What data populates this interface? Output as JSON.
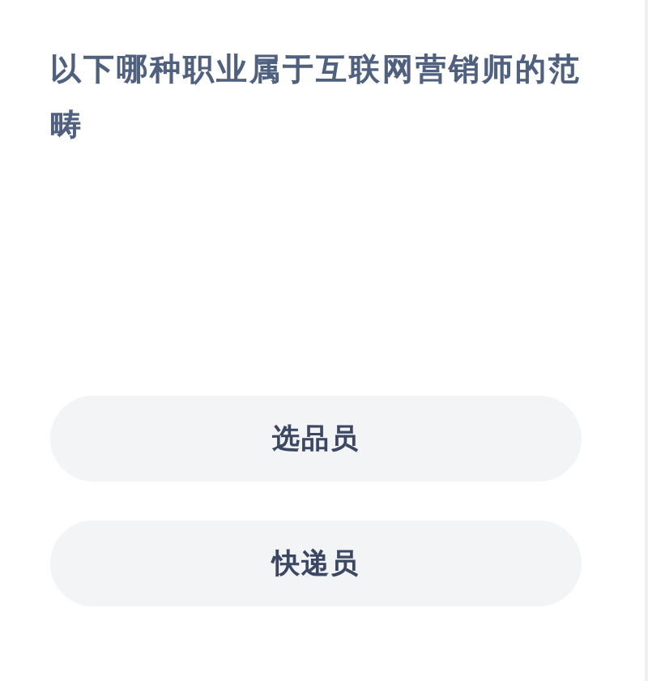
{
  "question": "以下哪种职业属于互联网营销师的范畴",
  "options": [
    {
      "label": "选品员"
    },
    {
      "label": "快递员"
    }
  ]
}
